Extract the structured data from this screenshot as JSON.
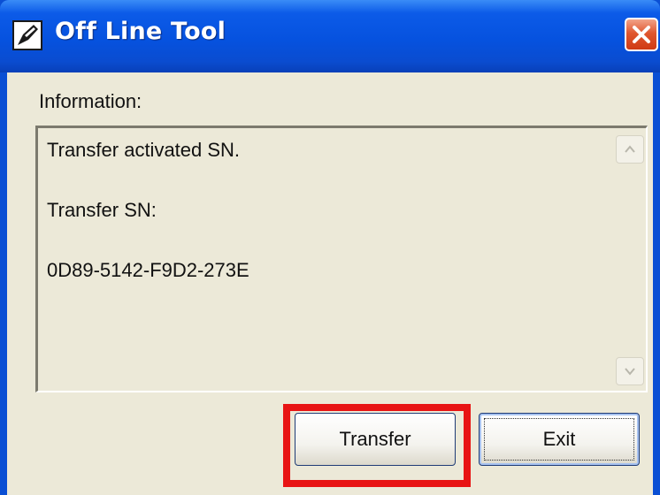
{
  "window": {
    "title": "Off Line Tool",
    "icon": "app-pen-icon",
    "close_icon": "close-icon"
  },
  "information": {
    "label": "Information:",
    "lines": [
      "Transfer activated SN.",
      "Transfer SN:",
      "0D89-5142-F9D2-273E"
    ]
  },
  "buttons": {
    "transfer_label": "Transfer",
    "exit_label": "Exit"
  },
  "colors": {
    "titlebar": "#0652df",
    "client_bg": "#ece9d8",
    "highlight": "#e81414",
    "close_button": "#e0572f"
  }
}
